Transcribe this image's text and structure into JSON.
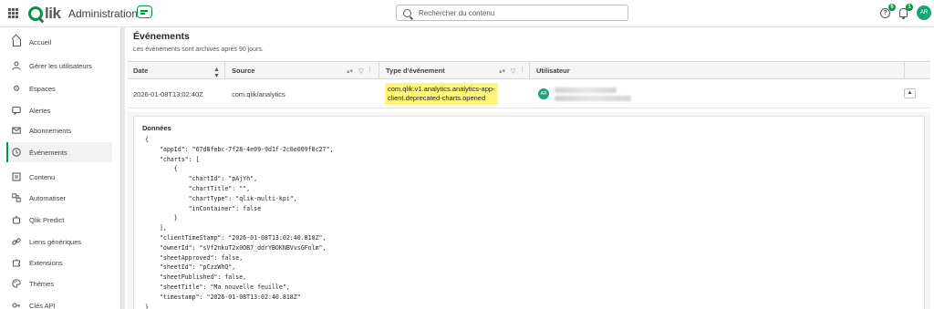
{
  "header": {
    "app_title": "Administration",
    "search_placeholder": "Rechercher du contenu",
    "help_badge": "6",
    "notif_badge": "1",
    "avatar_initials": "AR",
    "brand_color": "#009845"
  },
  "sidebar": {
    "items": [
      {
        "label": "Accueil",
        "icon": "home-icon"
      },
      {
        "label": "Gérer les utilisateurs",
        "icon": "user-icon"
      },
      {
        "label": "Espaces",
        "icon": "gear-icon"
      },
      {
        "label": "Alertes",
        "icon": "alert-icon"
      },
      {
        "label": "Abonnements",
        "icon": "mail-icon"
      },
      {
        "label": "Événements",
        "icon": "clock-icon",
        "active": true
      },
      {
        "label": "Contenu",
        "icon": "document-icon"
      },
      {
        "label": "Automatiser",
        "icon": "automation-icon"
      },
      {
        "label": "Qlik Predict",
        "icon": "predict-icon"
      },
      {
        "label": "Liens génériques",
        "icon": "link-icon"
      },
      {
        "label": "Extensions",
        "icon": "extensions-icon"
      },
      {
        "label": "Thèmes",
        "icon": "palette-icon"
      },
      {
        "label": "Clés API",
        "icon": "key-icon"
      }
    ]
  },
  "main": {
    "title": "Événements",
    "subtitle": "Les événements sont archivés après 90 jours.",
    "columns": [
      "Date",
      "Source",
      "Type d'événement",
      "Utilisateur"
    ],
    "row": {
      "date": "2026-01-08T13:02:40Z",
      "source": "com.qlik/analytics",
      "event_type": "com.qlik.v1.analytics.analytics-app-client.deprecated-charts.opened",
      "event_type_line1": "com.qlik.v1.analytics.analytics-app-",
      "event_type_line2": "client.deprecated-charts.opened",
      "user_initials": "AR"
    },
    "detail_label": "Données",
    "json_lines": [
      "{",
      "    \"appId\": \"67d8febc-7f28-4e09-9d1f-2c0e009f0c27\",",
      "    \"charts\": [",
      "        {",
      "            \"chartId\": \"pAjYh\",",
      "            \"chartTitle\": \"\",",
      "            \"chartType\": \"qlik-multi-kpi\",",
      "            \"inContainer\": false",
      "        }",
      "    ],",
      "    \"clientTimeStamp\": \"2026-01-08T13:02:40.818Z\",",
      "    \"ownerId\": \"sVf2nkuT2x0OB7_ddrYBOKNBVvsGFolm\",",
      "    \"sheetApproved\": false,",
      "    \"sheetId\": \"pCzzWhQ\",",
      "    \"sheetPublished\": false,",
      "    \"sheetTitle\": \"Ma nouvelle feuille\",",
      "    \"timestamp\": \"2026-01-08T13:02:40.818Z\"",
      "}"
    ]
  }
}
